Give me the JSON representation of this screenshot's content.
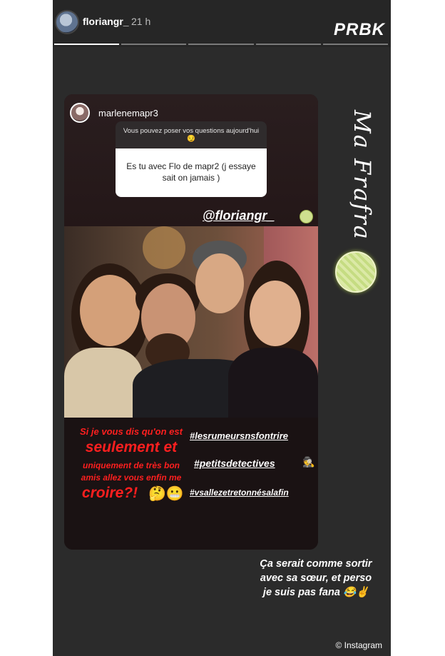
{
  "header": {
    "username": "floriangr_",
    "time": "21 h",
    "brand": "PRBK"
  },
  "card": {
    "username": "marlenemapr3",
    "question_prompt": "Vous pouvez poser vos questions aujourd'hui 😏",
    "question_answer": "Es tu avec Flo de mapr2 (j essaye sait on jamais )",
    "mention": "@floriangr_",
    "caption_red": [
      "Si je vous dis qu'on est",
      "seulement et",
      "uniquement de très bon",
      "amis allez vous enfin me",
      "croire?!"
    ],
    "caption_emoji": "🤔😬",
    "hashtags": [
      "#lesrumeursnsfontrire",
      "#petitsdetectives",
      "#vsallezetretonnésalafin"
    ],
    "hashtag_emoji": "🕵"
  },
  "side_text": "Ma Frafra",
  "note_lines": [
    "Ça serait comme sortir",
    "avec sa sœur, et perso",
    "je suis pas fana 😂✌"
  ],
  "credit": "© Instagram",
  "colors": {
    "background": "#2b2b2b",
    "caption_red": "#ff1f1f"
  }
}
